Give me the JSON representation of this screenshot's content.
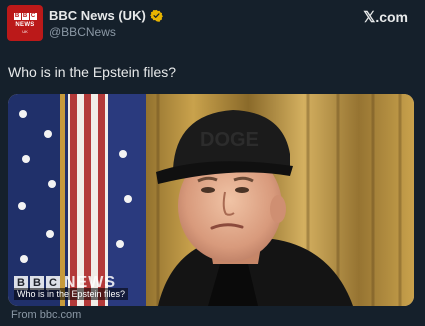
{
  "account": {
    "display_name": "BBC News (UK)",
    "handle": "@BBCNews",
    "avatar_lines": [
      "B",
      "B",
      "C"
    ],
    "avatar_news": "NEWS",
    "avatar_uk": "UK",
    "verified_icon": "verified-badge-icon",
    "verified_color": "#e8b400"
  },
  "brand": {
    "x_mark": "𝕏",
    "domain": ".com"
  },
  "tweet": {
    "text": "Who is in the Epstein files?"
  },
  "media": {
    "caption": "Who is in the Epstein files?",
    "watermark_blocks": [
      "B",
      "B",
      "C"
    ],
    "watermark_word": "NEWS",
    "cap_text": "DOGE"
  },
  "footer": {
    "source": "From bbc.com"
  },
  "colors": {
    "background": "#15202b",
    "avatar_red": "#bb1919",
    "secondary_text": "#8b98a5"
  }
}
